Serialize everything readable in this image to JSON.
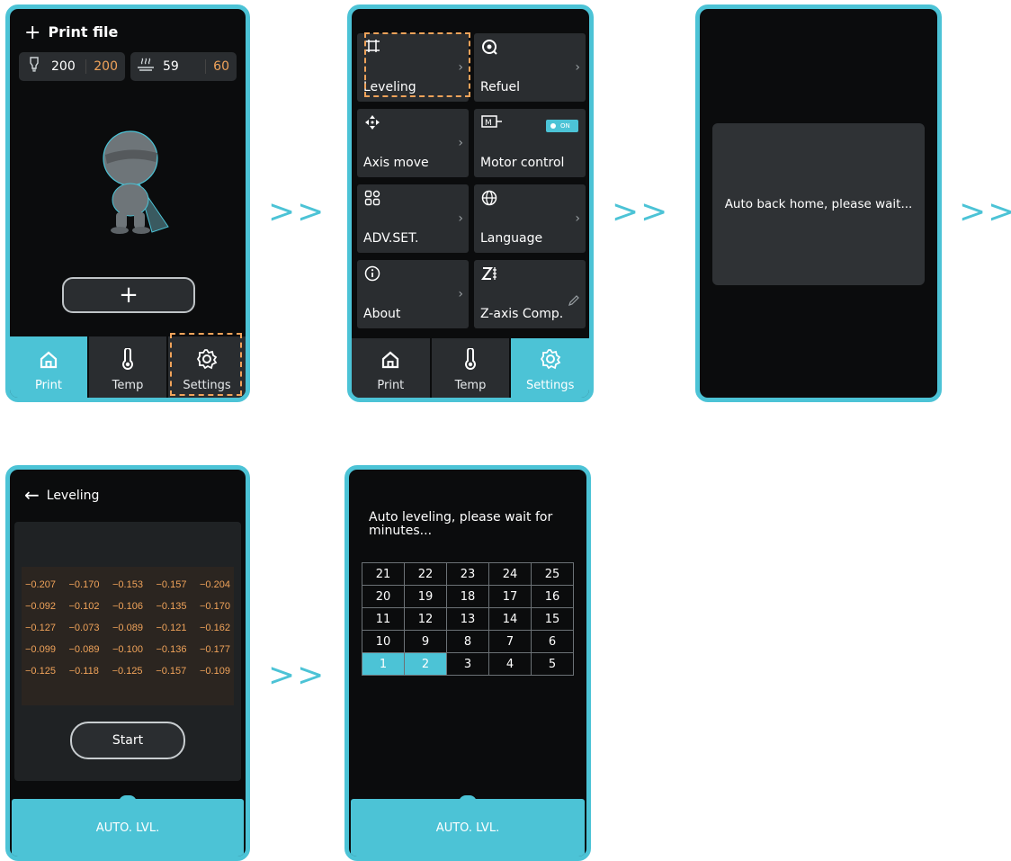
{
  "arrow": ">>",
  "screen1": {
    "title": "Print file",
    "nozzle": {
      "icon": "nozzle-temp-icon",
      "current": "200",
      "target": "200"
    },
    "bed": {
      "icon": "bed-temp-icon",
      "current": "59",
      "target": "60"
    },
    "add_label": "+",
    "tabs": [
      {
        "label": "Print",
        "icon": "home-icon",
        "active": true
      },
      {
        "label": "Temp",
        "icon": "thermometer-icon",
        "active": false
      },
      {
        "label": "Settings",
        "icon": "gear-icon",
        "active": false
      }
    ]
  },
  "screen2": {
    "tiles": [
      {
        "label": "Leveling",
        "icon": "leveling-icon"
      },
      {
        "label": "Refuel",
        "icon": "filament-icon"
      },
      {
        "label": "Axis move",
        "icon": "axis-move-icon"
      },
      {
        "label": "Motor control",
        "icon": "motor-icon",
        "toggle": "ON"
      },
      {
        "label": "ADV.SET.",
        "icon": "advanced-settings-icon"
      },
      {
        "label": "Language",
        "icon": "globe-icon"
      },
      {
        "label": "About",
        "icon": "info-icon"
      },
      {
        "label": "Z-axis Comp.",
        "icon": "z-axis-icon"
      }
    ],
    "tabs": [
      {
        "label": "Print",
        "icon": "home-icon",
        "active": false
      },
      {
        "label": "Temp",
        "icon": "thermometer-icon",
        "active": false
      },
      {
        "label": "Settings",
        "icon": "gear-icon",
        "active": true
      }
    ]
  },
  "screen3": {
    "message": "Auto back home, please wait..."
  },
  "screen4": {
    "title": "Leveling",
    "values": [
      [
        "−0.207",
        "−0.170",
        "−0.153",
        "−0.157",
        "−0.204"
      ],
      [
        "−0.092",
        "−0.102",
        "−0.106",
        "−0.135",
        "−0.170"
      ],
      [
        "−0.127",
        "−0.073",
        "−0.089",
        "−0.121",
        "−0.162"
      ],
      [
        "−0.099",
        "−0.089",
        "−0.100",
        "−0.136",
        "−0.177"
      ],
      [
        "−0.125",
        "−0.118",
        "−0.125",
        "−0.157",
        "−0.109"
      ]
    ],
    "start_label": "Start",
    "bottom_label": "AUTO. LVL."
  },
  "screen5": {
    "message": "Auto leveling, please wait for minutes...",
    "grid": [
      [
        "21",
        "22",
        "23",
        "24",
        "25"
      ],
      [
        "20",
        "19",
        "18",
        "17",
        "16"
      ],
      [
        "11",
        "12",
        "13",
        "14",
        "15"
      ],
      [
        "10",
        "9",
        "8",
        "7",
        "6"
      ],
      [
        "1",
        "2",
        "3",
        "4",
        "5"
      ]
    ],
    "completed_points": [
      "1",
      "2"
    ],
    "bottom_label": "AUTO. LVL."
  }
}
